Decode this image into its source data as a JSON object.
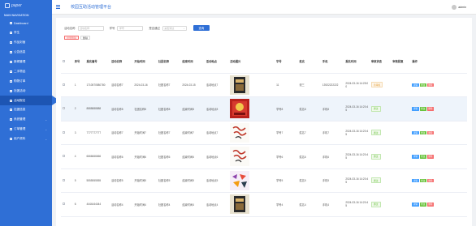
{
  "sidebar": {
    "logo_text": "paper",
    "section_label": "MAIN NAVIGATION",
    "items": [
      {
        "label": "Dashboard",
        "icon": "home-icon",
        "chevron": ""
      },
      {
        "label": "学生",
        "icon": "user-icon",
        "chevron": ""
      },
      {
        "label": "作品封面",
        "icon": "image-icon",
        "chevron": ""
      },
      {
        "label": "公告信息",
        "icon": "bell-icon",
        "chevron": ""
      },
      {
        "label": "新闻管理",
        "icon": "news-icon",
        "chevron": ""
      },
      {
        "label": "二手物品",
        "icon": "box-icon",
        "chevron": ""
      },
      {
        "label": "购物订单",
        "icon": "cart-icon",
        "chevron": ""
      },
      {
        "label": "社团活动",
        "icon": "group-icon",
        "chevron": ""
      },
      {
        "label": "活动报名",
        "icon": "person-icon",
        "chevron": "",
        "active": true
      },
      {
        "label": "社团信息",
        "icon": "list-icon",
        "chevron": ""
      },
      {
        "label": "系统管理",
        "icon": "gear-icon",
        "chevron": "⌄"
      },
      {
        "label": "订单管理",
        "icon": "order-icon",
        "chevron": "⌄"
      },
      {
        "label": "用户资料",
        "icon": "profile-icon",
        "chevron": "⌄"
      }
    ]
  },
  "header": {
    "title": "校园互助活动管理平台",
    "username": "admin"
  },
  "search": {
    "activity_name_label": "活动名称",
    "activity_name_placeholder": "活动名称",
    "student_id_label": "学号",
    "student_id_placeholder": "学号",
    "audit_label": "是否通过",
    "audit_placeholder": "是否通过",
    "search_button": "查询"
  },
  "actions": {
    "batch_delete": "批量删除",
    "delete": "删除"
  },
  "table": {
    "headers": [
      "",
      "序号",
      "报名编号",
      "活动名称",
      "开始时间",
      "社团名称",
      "结束时间",
      "活动地点",
      "活动图片",
      "学号",
      "姓名",
      "手机",
      "报名时间",
      "审核状态",
      "审核回复",
      "操作"
    ],
    "rows": [
      {
        "no": "1",
        "id": "1710570580780",
        "name": "活动名称7",
        "start": "2024-03-16",
        "club": "社团名称7",
        "end": "2024-03-15",
        "place": "活动地点7",
        "student": "11",
        "realname": "张三",
        "phone": "13922222222",
        "time": "2024-03-16 14:25:00",
        "status": "待审核",
        "status_type": "pending",
        "reply": "",
        "img": "book"
      },
      {
        "no": "2",
        "id": "8888888888",
        "name": "活动名称8",
        "start": "社团名称8",
        "club": "社团名称8",
        "end": "结束时间8",
        "place": "活动地点8",
        "student": "学号8",
        "realname": "姓名8",
        "phone": "手机8",
        "time": "2024-03-16 14:20:45",
        "status": "通过",
        "status_type": "ok",
        "reply": "",
        "img": "redposter"
      },
      {
        "no": "3",
        "id": "7777777777",
        "name": "活动名称7",
        "start": "开始时间7",
        "club": "社团名称7",
        "end": "结束时间7",
        "place": "活动地点7",
        "student": "学号7",
        "realname": "姓名7",
        "phone": "手机7",
        "time": "2024-03-16 14:20:45",
        "status": "通过",
        "status_type": "ok",
        "reply": "",
        "img": "calligraphy"
      },
      {
        "no": "4",
        "id": "6666666666",
        "name": "活动名称6",
        "start": "开始时间6",
        "club": "社团名称6",
        "end": "结束时间6",
        "place": "活动地点6",
        "student": "学号6",
        "realname": "姓名6",
        "phone": "手机6",
        "time": "2024-03-16 14:20:45",
        "status": "通过",
        "status_type": "ok",
        "reply": "",
        "img": "calligraphy"
      },
      {
        "no": "5",
        "id": "5555555555",
        "name": "活动名称5",
        "start": "开始时间5",
        "club": "社团名称5",
        "end": "结束时间5",
        "place": "活动地点5",
        "student": "学号5",
        "realname": "姓名5",
        "phone": "手机5",
        "time": "2024-03-16 14:20:45",
        "status": "通过",
        "status_type": "ok",
        "reply": "",
        "img": "colorful"
      },
      {
        "no": "6",
        "id": "4444444444",
        "name": "活动名称4",
        "start": "开始时间4",
        "club": "社团名称4",
        "end": "结束时间4",
        "place": "活动地点4",
        "student": "学号4",
        "realname": "姓名4",
        "phone": "手机4",
        "time": "2024-03-16 14:20:45",
        "status": "通过",
        "status_type": "ok",
        "reply": "",
        "img": "book"
      }
    ],
    "op_detail": "详情",
    "op_edit": "修改",
    "op_delete": "删除"
  },
  "colors": {
    "sidebar": "#2f6fd6",
    "accent": "#409eff",
    "success": "#67c23a",
    "danger": "#f56c6c",
    "warning": "#e6a23c"
  }
}
